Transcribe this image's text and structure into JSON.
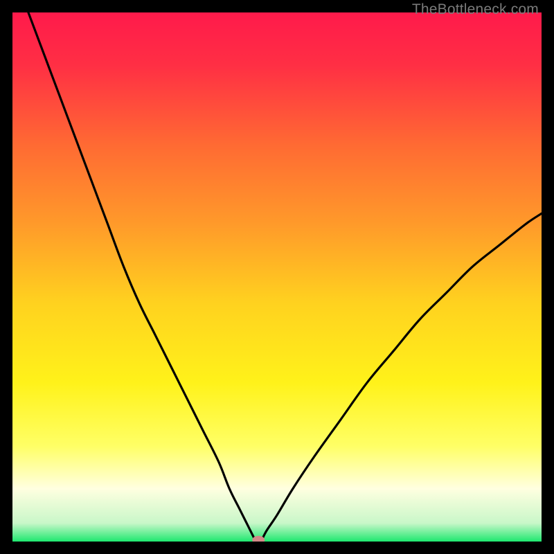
{
  "watermark": "TheBottleneck.com",
  "chart_data": {
    "type": "line",
    "title": "",
    "xlabel": "",
    "ylabel": "",
    "xlim": [
      0,
      100
    ],
    "ylim": [
      0,
      100
    ],
    "grid": false,
    "legend": false,
    "background_gradient_stops": [
      {
        "offset": 0.0,
        "color": "#ff1a4b"
      },
      {
        "offset": 0.1,
        "color": "#ff2f44"
      },
      {
        "offset": 0.25,
        "color": "#ff6a33"
      },
      {
        "offset": 0.4,
        "color": "#ff9a2a"
      },
      {
        "offset": 0.55,
        "color": "#ffd21f"
      },
      {
        "offset": 0.7,
        "color": "#fff21a"
      },
      {
        "offset": 0.82,
        "color": "#ffff66"
      },
      {
        "offset": 0.9,
        "color": "#ffffe0"
      },
      {
        "offset": 0.965,
        "color": "#c9f7c9"
      },
      {
        "offset": 1.0,
        "color": "#1ee86f"
      }
    ],
    "series": [
      {
        "name": "left-branch",
        "x": [
          3,
          6,
          9,
          12,
          15,
          18,
          21,
          24,
          27,
          30,
          33,
          36,
          39,
          41,
          43,
          44.5,
          45.5,
          46
        ],
        "values": [
          100,
          92,
          84,
          76,
          68,
          60,
          52,
          45,
          39,
          33,
          27,
          21,
          15,
          10,
          6,
          3,
          1,
          0
        ]
      },
      {
        "name": "right-branch",
        "x": [
          47,
          48,
          50,
          53,
          57,
          62,
          67,
          72,
          77,
          82,
          87,
          92,
          97,
          100
        ],
        "values": [
          0,
          2,
          5,
          10,
          16,
          23,
          30,
          36,
          42,
          47,
          52,
          56,
          60,
          62
        ]
      }
    ],
    "marker": {
      "x": 46.5,
      "y": 0.3,
      "color": "#d38a88",
      "rx": 9,
      "ry": 6
    }
  }
}
